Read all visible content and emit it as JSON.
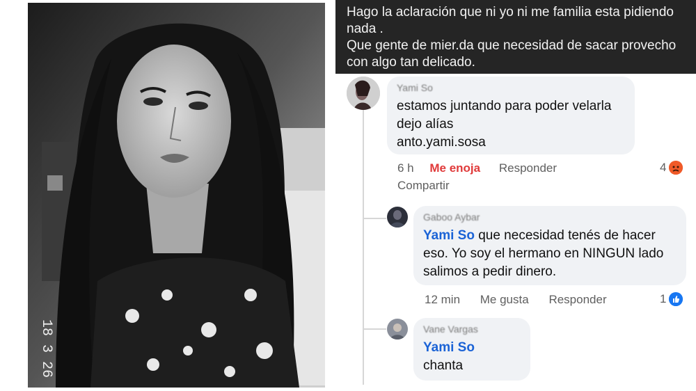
{
  "post": {
    "line1": "Hago la aclaración que ni yo ni me familia esta pidiendo nada .",
    "line2": "Que gente de mier.da que necesidad de sacar provecho con algo tan delicado."
  },
  "comments": [
    {
      "author": "Yami So",
      "lines": [
        "estamos juntando para poder velarla",
        "dejo alías",
        "anto.yami.sosa"
      ],
      "time": "6 h",
      "reaction_label": "Me enoja",
      "reply_label": "Responder",
      "share_label": "Compartir",
      "reaction_count": "4"
    },
    {
      "author": "Gaboo Aybar",
      "mention": "Yami So",
      "text_after_mention": " que necesidad tenés de hacer",
      "lines": [
        "eso. Yo soy el hermano en NINGUN lado",
        "salimos a pedir dinero."
      ],
      "time": "12 min",
      "reaction_label": "Me gusta",
      "reply_label": "Responder",
      "reaction_count": "1"
    },
    {
      "author": "Vane Vargas",
      "mention": "Yami So",
      "lines": [
        "chanta"
      ]
    }
  ],
  "photo_overlay_text": "18 3 26",
  "colors": {
    "link": "#1b63d6",
    "angry": "#e03a3a",
    "like": "#1877f2",
    "post_bg": "#252525"
  }
}
